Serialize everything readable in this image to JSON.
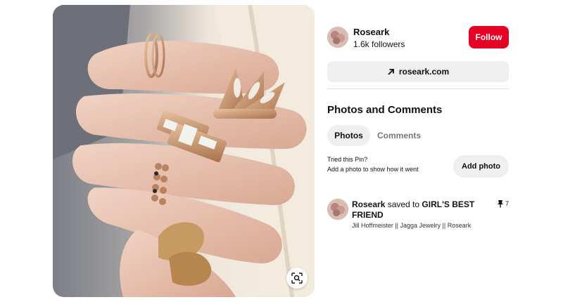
{
  "pin": {
    "image_alt": "Hand wearing rose gold and diamond rings",
    "lens_icon": "visual-search-icon"
  },
  "creator": {
    "name": "Roseark",
    "followers": "1.6k followers",
    "follow_label": "Follow"
  },
  "website": {
    "label": "roseark.com",
    "icon": "arrow-up-right-icon"
  },
  "photos_comments": {
    "title": "Photos and Comments",
    "tabs": [
      {
        "label": "Photos",
        "active": true
      },
      {
        "label": "Comments",
        "active": false
      }
    ],
    "tried_title": "Tried this Pin?",
    "tried_sub": "Add a photo to show how it went",
    "add_photo_label": "Add photo"
  },
  "activity": {
    "user": "Roseark",
    "action": " saved to ",
    "board": "GIRL'S BEST FRIEND",
    "description": "Jill Hoffmeister || Jagga Jewelry || Roseark",
    "pin_count": "7"
  },
  "colors": {
    "follow": "#e60023",
    "chip": "#efefef"
  }
}
